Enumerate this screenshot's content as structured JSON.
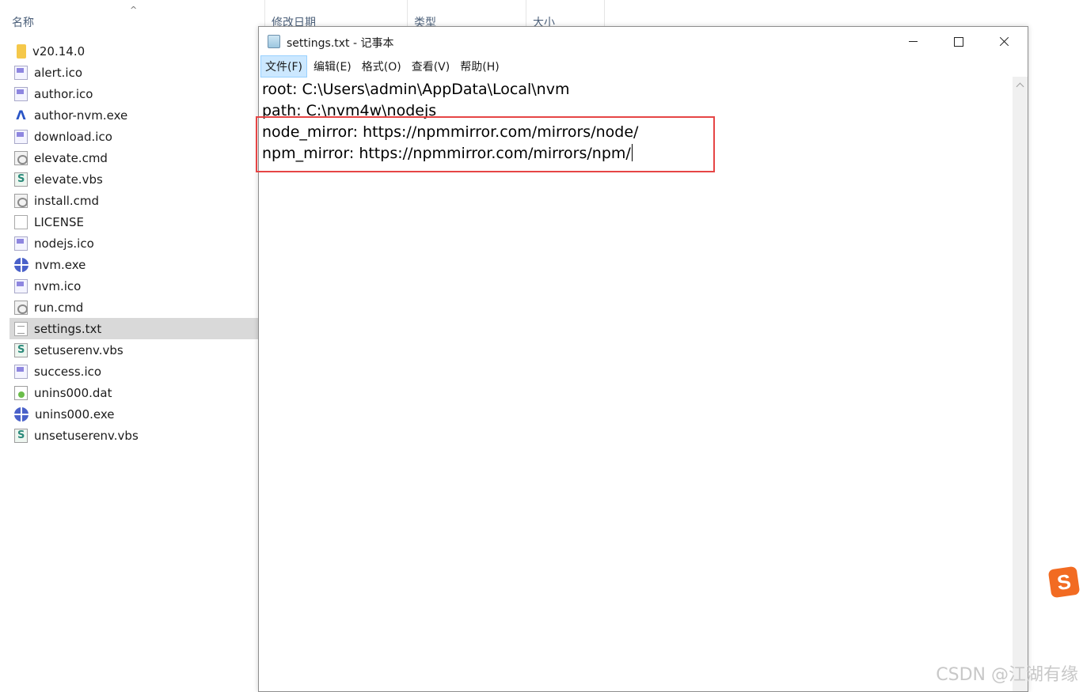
{
  "explorer": {
    "sort_indicator": "^",
    "columns": {
      "name": "名称",
      "date": "修改日期",
      "type": "类型",
      "size": "大小"
    },
    "files": [
      {
        "name": "v20.14.0",
        "icon": "folder-icon"
      },
      {
        "name": "alert.ico",
        "icon": "image-file-icon"
      },
      {
        "name": "author.ico",
        "icon": "image-file-icon"
      },
      {
        "name": "author-nvm.exe",
        "icon": "exe-app-icon"
      },
      {
        "name": "download.ico",
        "icon": "image-file-icon"
      },
      {
        "name": "elevate.cmd",
        "icon": "script-file-icon"
      },
      {
        "name": "elevate.vbs",
        "icon": "vbs-file-icon"
      },
      {
        "name": "install.cmd",
        "icon": "script-file-icon"
      },
      {
        "name": "LICENSE",
        "icon": "document-file-icon"
      },
      {
        "name": "nodejs.ico",
        "icon": "image-file-icon"
      },
      {
        "name": "nvm.exe",
        "icon": "globe-app-icon"
      },
      {
        "name": "nvm.ico",
        "icon": "image-file-icon"
      },
      {
        "name": "run.cmd",
        "icon": "script-file-icon"
      },
      {
        "name": "settings.txt",
        "icon": "text-file-icon",
        "selected": true
      },
      {
        "name": "setuserenv.vbs",
        "icon": "vbs-file-icon"
      },
      {
        "name": "success.ico",
        "icon": "image-file-icon"
      },
      {
        "name": "unins000.dat",
        "icon": "media-file-icon"
      },
      {
        "name": "unins000.exe",
        "icon": "globe-app-icon"
      },
      {
        "name": "unsetuserenv.vbs",
        "icon": "vbs-file-icon"
      }
    ]
  },
  "notepad": {
    "title": "settings.txt - 记事本",
    "menu": [
      {
        "label": "文件(F)",
        "active": true
      },
      {
        "label": "编辑(E)"
      },
      {
        "label": "格式(O)"
      },
      {
        "label": "查看(V)"
      },
      {
        "label": "帮助(H)"
      }
    ],
    "lines": [
      "root: C:\\Users\\admin\\AppData\\Local\\nvm",
      "path: C:\\nvm4w\\nodejs",
      "node_mirror: https://npmmirror.com/mirrors/node/",
      "npm_mirror: https://npmmirror.com/mirrors/npm/"
    ]
  },
  "overlay": {
    "ime_letter": "S",
    "watermark": "CSDN @江湖有缘"
  },
  "colors": {
    "highlight_box": "#e64545",
    "selection": "#d9d9d9",
    "menu_active": "#cce8ff",
    "ime_orange": "#f26b22"
  }
}
